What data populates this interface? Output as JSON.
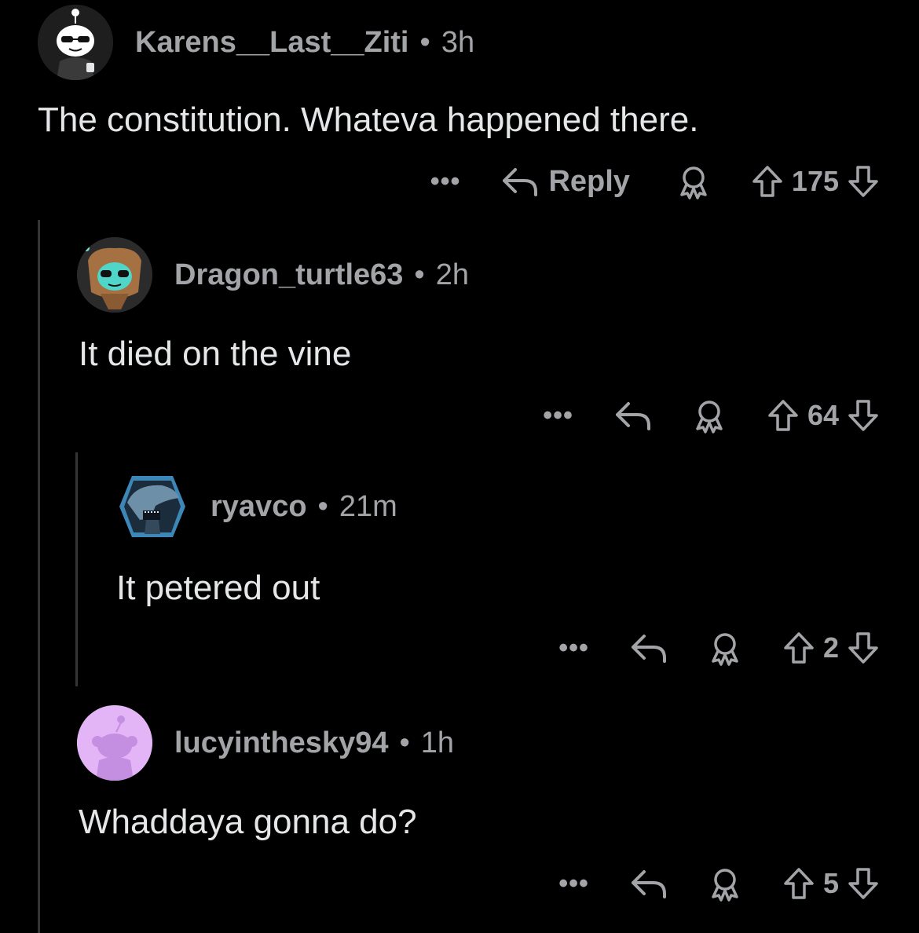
{
  "comments": [
    {
      "username": "Karens__Last__Ziti",
      "separator": "•",
      "age": "3h",
      "body": "The constitution. Whateva happened there.",
      "more": "•••",
      "reply_label": "Reply",
      "score": "175"
    },
    {
      "username": "Dragon_turtle63",
      "separator": "•",
      "age": "2h",
      "body": "It died on the vine",
      "more": "•••",
      "score": "64"
    },
    {
      "username": "ryavco",
      "separator": "•",
      "age": "21m",
      "body": "It petered out",
      "more": "•••",
      "score": "2"
    },
    {
      "username": "lucyinthesky94",
      "separator": "•",
      "age": "1h",
      "body": "Whaddaya gonna do?",
      "more": "•••",
      "score": "5"
    }
  ],
  "icons": {
    "more": "more-options-icon",
    "reply": "reply-arrow-icon",
    "award": "award-icon",
    "upvote": "upvote-arrow-icon",
    "downvote": "downvote-arrow-icon"
  },
  "colors": {
    "background": "#000000",
    "text": "#e4e6e8",
    "meta": "#a2a4a7",
    "thread_line": "#343536",
    "lucy_avatar_bg": "#e3b5f7"
  }
}
